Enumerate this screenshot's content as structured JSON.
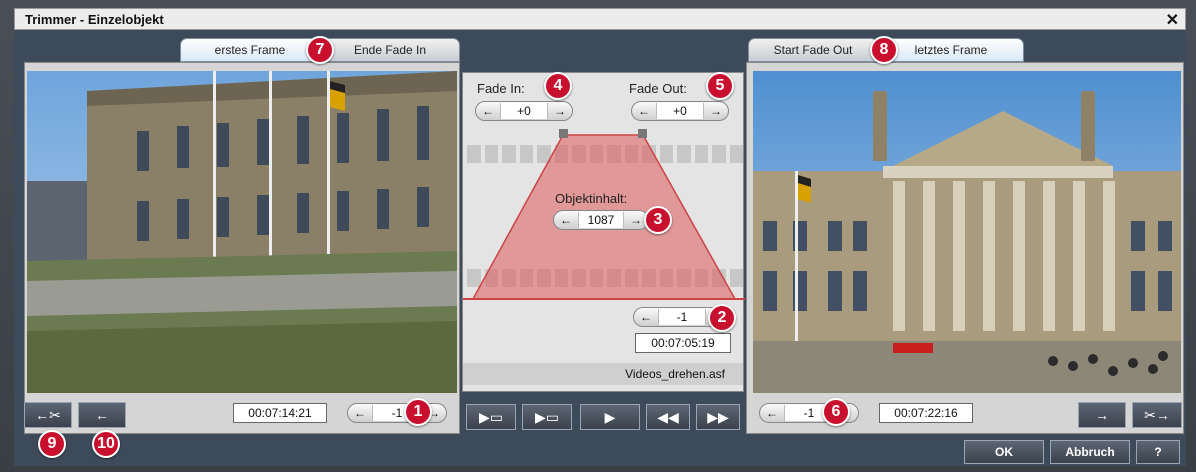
{
  "window": {
    "title": "Trimmer - Einzelobjekt",
    "close_glyph": "✕"
  },
  "left": {
    "tab_active": "erstes Frame",
    "tab_inactive": "Ende Fade In",
    "timecode": "00:07:14:21",
    "step_value": "-1",
    "step_left": "←",
    "step_right": "→",
    "image": "reichstag-side-view"
  },
  "right": {
    "tab_inactive": "Start Fade Out",
    "tab_active": "letztes Frame",
    "timecode": "00:07:22:16",
    "step_value": "-1",
    "step_left": "←",
    "step_right": "→",
    "image": "reichstag-front-view"
  },
  "center": {
    "fade_in_label": "Fade In:",
    "fade_in_value": "+0",
    "fade_out_label": "Fade Out:",
    "fade_out_value": "+0",
    "content_label": "Objektinhalt:",
    "content_value": "1087",
    "end_step_value": "-1",
    "end_timecode": "00:07:05:19",
    "filename": "Videos_drehen.asf",
    "arrow_left": "←",
    "arrow_right": "→"
  },
  "badges": [
    "1",
    "2",
    "3",
    "4",
    "5",
    "6",
    "7",
    "8",
    "9",
    "10"
  ],
  "toolbar": {
    "left_btn1": "←✂",
    "left_btn2": "←",
    "right_btn1": "→",
    "right_btn2": "✂→",
    "transport": [
      "▶▭",
      "▶▭",
      "▶",
      "◀◀",
      "▶▶"
    ]
  },
  "buttons": {
    "ok": "OK",
    "cancel": "Abbruch",
    "help": "?"
  },
  "colors": {
    "accent_red": "#c8102e",
    "fade_fill": "#e9a0a0",
    "dialog_bg": "#3d4a5a"
  }
}
